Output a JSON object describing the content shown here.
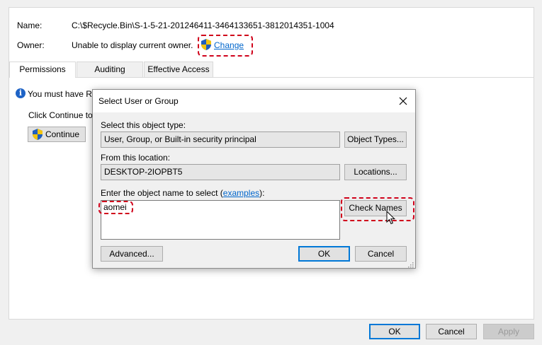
{
  "properties": {
    "name_label": "Name:",
    "name_value": "C:\\$Recycle.Bin\\S-1-5-21-201246411-3464133651-3812014351-1004",
    "owner_label": "Owner:",
    "owner_value": "Unable to display current owner.",
    "change_link": "Change",
    "tabs": [
      {
        "label": "Permissions"
      },
      {
        "label": "Auditing"
      },
      {
        "label": "Effective Access"
      }
    ],
    "notice_text": "You must have Re",
    "continue_prompt": "Click Continue to",
    "continue_button": "Continue"
  },
  "dialog": {
    "title": "Select User or Group",
    "object_type_label": "Select this object type:",
    "object_type_value": "User, Group, or Built-in security principal",
    "object_types_button": "Object Types...",
    "location_label": "From this location:",
    "location_value": "DESKTOP-2IOPBT5",
    "locations_button": "Locations...",
    "enter_label_prefix": "Enter the object name to select (",
    "examples_link": "examples",
    "enter_label_suffix": "):",
    "object_name_value": "aomei",
    "check_names_button": "Check Names",
    "advanced_button": "Advanced...",
    "ok_button": "OK",
    "cancel_button": "Cancel"
  },
  "footer": {
    "ok_button": "OK",
    "cancel_button": "Cancel",
    "apply_button": "Apply"
  },
  "colors": {
    "highlight": "#d0021b",
    "link": "#0066cc",
    "default_button_border": "#0078d7"
  }
}
